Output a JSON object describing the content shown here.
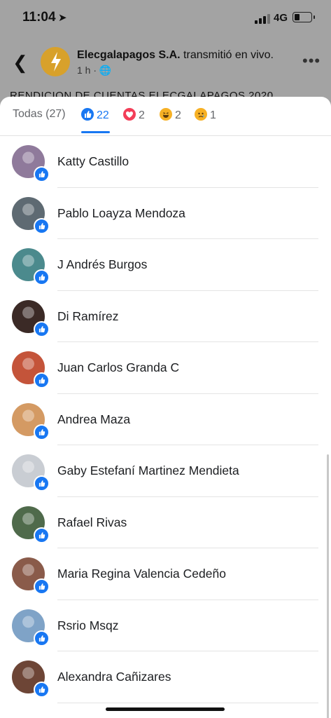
{
  "status_bar": {
    "time": "11:04",
    "network": "4G"
  },
  "post": {
    "page_name": "Elecgalapagos S.A.",
    "action_text": " transmitió en vivo.",
    "age": "1 h ·",
    "text": "RENDICION DE CUENTAS ELECGALAPAGOS 2020"
  },
  "tabs": {
    "all_label": "Todas (27)",
    "like_count": "22",
    "love_count": "2",
    "haha_count": "2",
    "sad_count": "1"
  },
  "people": [
    {
      "name": "Katty Castillo",
      "avatar_color": "#8f7a9b"
    },
    {
      "name": "Pablo Loayza Mendoza",
      "avatar_color": "#5e6a72"
    },
    {
      "name": "J Andrés Burgos",
      "avatar_color": "#4b8a8d"
    },
    {
      "name": "Di Ramírez",
      "avatar_color": "#3b2a26"
    },
    {
      "name": "Juan Carlos Granda C",
      "avatar_color": "#c4543a"
    },
    {
      "name": "Andrea Maza",
      "avatar_color": "#d49a63"
    },
    {
      "name": "Gaby Estefaní Martinez Mendieta",
      "avatar_color": "#c9cdd3"
    },
    {
      "name": "Rafael Rivas",
      "avatar_color": "#4f6a4b"
    },
    {
      "name": "Maria Regina Valencia Cedeño",
      "avatar_color": "#8a5b4a"
    },
    {
      "name": "Rsrio Msqz",
      "avatar_color": "#7fa3c7"
    },
    {
      "name": "Alexandra Cañizares",
      "avatar_color": "#6d4536"
    }
  ],
  "colors": {
    "accent": "#1877f2"
  }
}
